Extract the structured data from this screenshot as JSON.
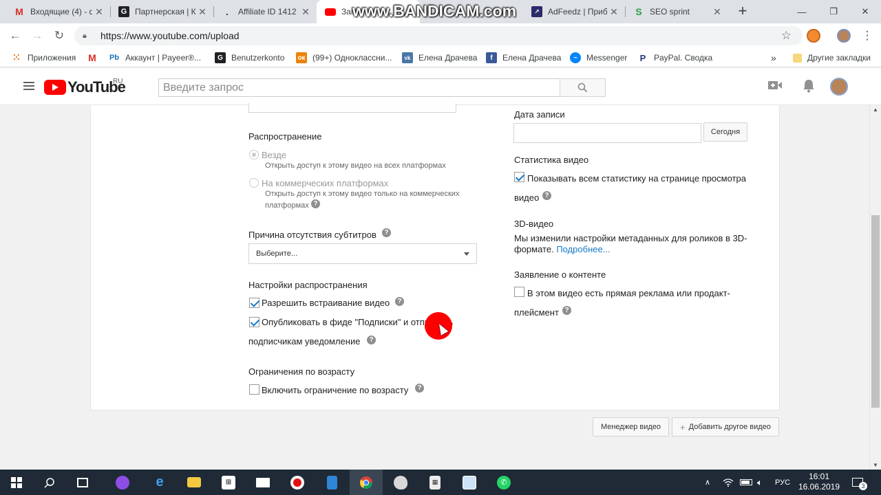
{
  "watermark": "www.BANDICAM.com",
  "tabs": [
    {
      "title": "Входящие (4) - d",
      "icon": "gmail-icon"
    },
    {
      "title": "Партнерская | К",
      "icon": "g-logo-icon"
    },
    {
      "title": "Affiliate ID 1412",
      "icon": "dot-icon"
    },
    {
      "title": "Загр",
      "icon": "youtube-icon"
    },
    {
      "title": "AdFeedz | Приб",
      "icon": "adfeedz-icon"
    },
    {
      "title": "SEO sprint",
      "icon": "seosprint-icon"
    }
  ],
  "window_controls": {
    "minimize": "—",
    "maximize": "❐",
    "close": "✕"
  },
  "address": {
    "url": "https://www.youtube.com/upload"
  },
  "bookmarks": [
    {
      "label": "Приложения",
      "icon": "apps-grid-icon"
    },
    {
      "label": "",
      "icon": "gmail-icon"
    },
    {
      "label": "Аккаунт | Payeer®...",
      "icon": "payeer-icon"
    },
    {
      "label": "Benutzerkonto",
      "icon": "g-logo-icon"
    },
    {
      "label": "(99+) Одноклассни...",
      "icon": "odnoklassniki-icon"
    },
    {
      "label": "Елена Драчева",
      "icon": "vk-icon"
    },
    {
      "label": "Елена Драчева",
      "icon": "facebook-icon"
    },
    {
      "label": "Messenger",
      "icon": "messenger-icon"
    },
    {
      "label": "PayPal. Сводка",
      "icon": "paypal-icon"
    }
  ],
  "bookmarks_more": "»",
  "other_bookmarks": "Другие закладки",
  "youtube": {
    "logo_text": "YouTube",
    "region": "RU",
    "search_placeholder": "Введите запрос"
  },
  "form": {
    "distribution_title": "Распространение",
    "everywhere_label": "Везде",
    "everywhere_sub": "Открыть доступ к этому видео на всех платформах",
    "commercial_label": "На коммерческих платформах",
    "commercial_sub1": "Открыть доступ к этому видео только на коммерческих",
    "commercial_sub2": "платформах",
    "subtitles_reason_title": "Причина отсутствия субтитров",
    "subtitles_select_value": "Выберите...",
    "distribution_settings_title": "Настройки распространения",
    "allow_embed_label": "Разрешить встраивание видео",
    "publish_feed_label1": "Опубликовать в фиде \"Подписки\" и отправить",
    "publish_feed_label2": "подписчикам уведомление",
    "age_title": "Ограничения по возрасту",
    "age_label": "Включить ограничение по возрасту",
    "record_date_title": "Дата записи",
    "today_button": "Сегодня",
    "stats_title": "Статистика видео",
    "stats_label1": "Показывать всем статистику на странице просмотра",
    "stats_label2": "видео",
    "video3d_title": "3D-видео",
    "video3d_text1": "Мы изменили настройки метаданных для роликов в 3D-",
    "video3d_text2": "формате.",
    "video3d_link": "Подробнее...",
    "content_title": "Заявление о контенте",
    "content_label1": "В этом видео есть прямая реклама или продакт-",
    "content_label2": "плейсмент"
  },
  "footer_buttons": {
    "video_manager": "Менеджер видео",
    "add_video": "Добавить другое видео"
  },
  "taskbar": {
    "language": "РУС",
    "time": "16:01",
    "date": "16.06.2019",
    "notifications": "3"
  }
}
